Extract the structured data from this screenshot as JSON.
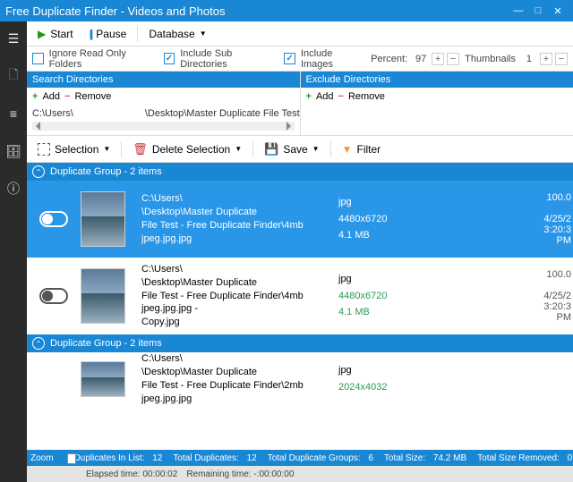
{
  "window": {
    "title": "Free Duplicate Finder - Videos and Photos"
  },
  "toolbar": {
    "start": "Start",
    "pause": "Pause",
    "database": "Database"
  },
  "options": {
    "ignore_label": "Ignore Read Only Folders",
    "include_sub_label": "Include Sub Directories",
    "include_images_label": "Include Images",
    "percent_label": "Percent:",
    "percent_value": "97",
    "thumbs_label": "Thumbnails",
    "thumbs_value": "1"
  },
  "dirs": {
    "search_hdr": "Search Directories",
    "exclude_hdr": "Exclude Directories",
    "add": "Add",
    "remove": "Remove",
    "path1": "C:\\Users\\",
    "path2": "\\Desktop\\Master Duplicate File Test - Free Dup"
  },
  "actions": {
    "selection": "Selection",
    "delete": "Delete Selection",
    "save": "Save",
    "filter": "Filter"
  },
  "group_label": "Duplicate Group - 2 items",
  "rows": [
    {
      "path_a": "C:\\Users\\",
      "path_b": "\\Desktop\\Master Duplicate",
      "line2": "File Test - Free Duplicate Finder\\4mb jpeg.jpg.jpg",
      "ext": "jpg",
      "dim": "4480x6720",
      "size": "4.1 MB",
      "pct": "100.0",
      "date_a": "4/25/2",
      "date_b": "3:20:3",
      "date_c": "PM"
    },
    {
      "path_a": "C:\\Users\\",
      "path_b": "\\Desktop\\Master Duplicate",
      "line2": "File Test - Free Duplicate Finder\\4mb jpeg.jpg.jpg -",
      "line3": "Copy.jpg",
      "ext": "jpg",
      "dim": "4480x6720",
      "size": "4.1 MB",
      "pct": "100.0",
      "date_a": "4/25/2",
      "date_b": "3:20:3",
      "date_c": "PM"
    },
    {
      "path_a": "C:\\Users\\",
      "path_b": "\\Desktop\\Master Duplicate",
      "line2": "File Test - Free Duplicate Finder\\2mb jpeg.jpg.jpg",
      "ext": "jpg",
      "dim": "2024x4032",
      "size": "",
      "pct": "",
      "date_a": "",
      "date_b": "",
      "date_c": ""
    }
  ],
  "status": {
    "zoom": "Zoom",
    "dup_in_list_l": "Duplicates In List:",
    "dup_in_list_v": "12",
    "total_dup_l": "Total Duplicates:",
    "total_dup_v": "12",
    "groups_l": "Total Duplicate Groups:",
    "groups_v": "6",
    "size_l": "Total Size:",
    "size_v": "74.2 MB",
    "removed_l": "Total Size Removed:",
    "removed_v": "0",
    "elapsed_l": "Elapsed time:",
    "elapsed_v": "00:00:02",
    "remain_l": "Remaining time:",
    "remain_v": "-:00:00:00"
  }
}
